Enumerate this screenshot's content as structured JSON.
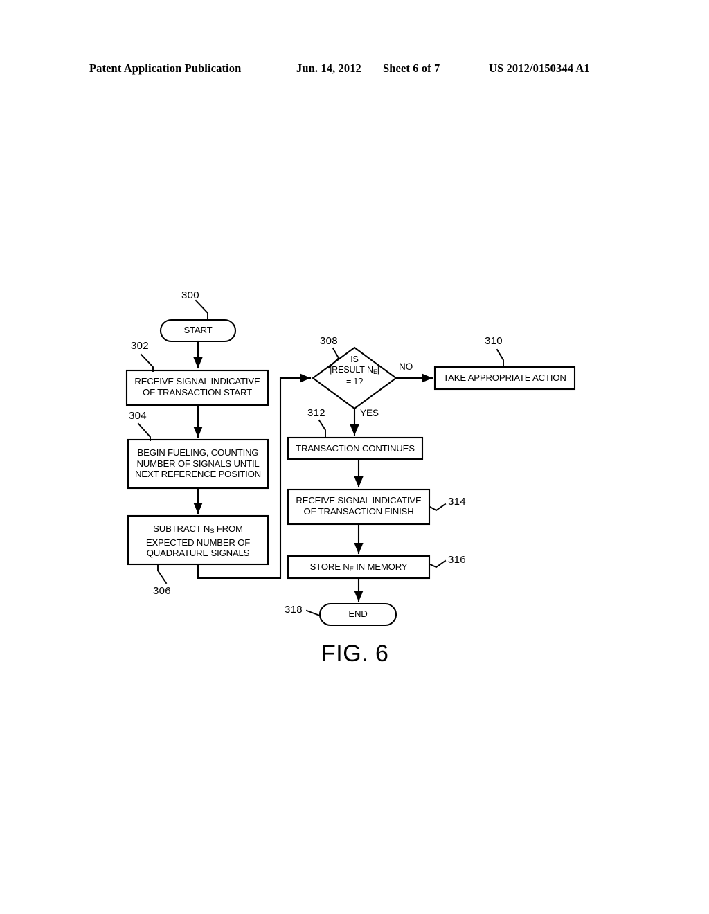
{
  "header": {
    "left": "Patent Application Publication",
    "date": "Jun. 14, 2012",
    "sheet": "Sheet 6 of 7",
    "patent_number": "US 2012/0150344 A1"
  },
  "figure": {
    "caption": "FIG. 6",
    "nodes": [
      {
        "ref": "300",
        "id": "start",
        "shape": "terminator",
        "text": "START"
      },
      {
        "ref": "302",
        "id": "receive-start",
        "shape": "process",
        "text": "RECEIVE SIGNAL INDICATIVE OF TRANSACTION START"
      },
      {
        "ref": "304",
        "id": "begin-fueling",
        "shape": "process",
        "text": "BEGIN FUELING, COUNTING NUMBER OF SIGNALS UNTIL NEXT REFERENCE POSITION"
      },
      {
        "ref": "306",
        "id": "subtract",
        "shape": "process",
        "text": "SUBTRACT N<sub>S</sub> FROM EXPECTED NUMBER OF QUADRATURE SIGNALS"
      },
      {
        "ref": "308",
        "id": "decision",
        "shape": "decision",
        "text": "IS |RESULT-N<sub>E</sub>| = 1?"
      },
      {
        "ref": "310",
        "id": "take-action",
        "shape": "process",
        "text": "TAKE APPROPRIATE ACTION"
      },
      {
        "ref": "312",
        "id": "transaction-cont",
        "shape": "process",
        "text": "TRANSACTION CONTINUES"
      },
      {
        "ref": "314",
        "id": "receive-finish",
        "shape": "process",
        "text": "RECEIVE SIGNAL INDICATIVE OF TRANSACTION FINISH"
      },
      {
        "ref": "316",
        "id": "store-ne",
        "shape": "process",
        "text": "STORE N<sub>E</sub> IN MEMORY"
      },
      {
        "ref": "318",
        "id": "end",
        "shape": "terminator",
        "text": "END"
      }
    ],
    "edge_labels": {
      "no": "NO",
      "yes": "YES"
    },
    "node_text": {
      "start": "START",
      "receive_start_line1": "RECEIVE SIGNAL INDICATIVE",
      "receive_start_line2": "OF TRANSACTION START",
      "begin_fueling_line1": "BEGIN FUELING, COUNTING",
      "begin_fueling_line2": "NUMBER OF SIGNALS UNTIL",
      "begin_fueling_line3": "NEXT REFERENCE POSITION",
      "subtract_line1_pre": "SUBTRACT N",
      "subtract_line1_sub": "S",
      "subtract_line1_post": " FROM",
      "subtract_line2": "EXPECTED NUMBER OF",
      "subtract_line3": "QUADRATURE SIGNALS",
      "decision_line1": "IS",
      "decision_line2_pre": "|RESULT-N",
      "decision_line2_sub": "E",
      "decision_line2_post": "|",
      "decision_line3": "= 1?",
      "take_action": "TAKE APPROPRIATE ACTION",
      "transaction_continues": "TRANSACTION CONTINUES",
      "receive_finish_line1": "RECEIVE SIGNAL INDICATIVE",
      "receive_finish_line2": "OF TRANSACTION FINISH",
      "store_ne_pre": "STORE N",
      "store_ne_sub": "E",
      "store_ne_post": " IN MEMORY",
      "end": "END"
    },
    "ref_numbers": {
      "n300": "300",
      "n302": "302",
      "n304": "304",
      "n306": "306",
      "n308": "308",
      "n310": "310",
      "n312": "312",
      "n314": "314",
      "n316": "316",
      "n318": "318"
    }
  },
  "colors": {
    "ink": "#000000",
    "paper": "#ffffff"
  }
}
